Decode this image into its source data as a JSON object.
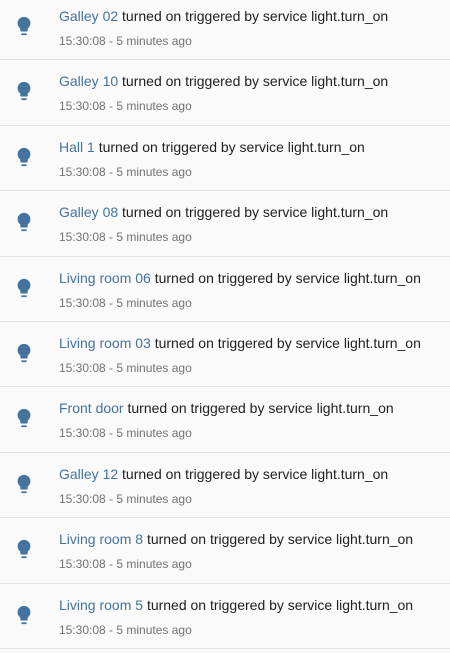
{
  "logbook": {
    "icon": "lightbulb-icon",
    "accent_color": "#44739e",
    "entries": [
      {
        "entity": "Galley 02",
        "message": "turned on triggered by service light.turn_on",
        "time": "15:30:08",
        "relative": "5 minutes ago"
      },
      {
        "entity": "Galley 10",
        "message": "turned on triggered by service light.turn_on",
        "time": "15:30:08",
        "relative": "5 minutes ago"
      },
      {
        "entity": "Hall 1",
        "message": "turned on triggered by service light.turn_on",
        "time": "15:30:08",
        "relative": "5 minutes ago"
      },
      {
        "entity": "Galley 08",
        "message": "turned on triggered by service light.turn_on",
        "time": "15:30:08",
        "relative": "5 minutes ago"
      },
      {
        "entity": "Living room 06",
        "message": "turned on triggered by service light.turn_on",
        "time": "15:30:08",
        "relative": "5 minutes ago"
      },
      {
        "entity": "Living room 03",
        "message": "turned on triggered by service light.turn_on",
        "time": "15:30:08",
        "relative": "5 minutes ago"
      },
      {
        "entity": "Front door",
        "message": "turned on triggered by service light.turn_on",
        "time": "15:30:08",
        "relative": "5 minutes ago"
      },
      {
        "entity": "Galley 12",
        "message": "turned on triggered by service light.turn_on",
        "time": "15:30:08",
        "relative": "5 minutes ago"
      },
      {
        "entity": "Living room 8",
        "message": "turned on triggered by service light.turn_on",
        "time": "15:30:08",
        "relative": "5 minutes ago"
      },
      {
        "entity": "Living room 5",
        "message": "turned on triggered by service light.turn_on",
        "time": "15:30:08",
        "relative": "5 minutes ago"
      }
    ]
  }
}
